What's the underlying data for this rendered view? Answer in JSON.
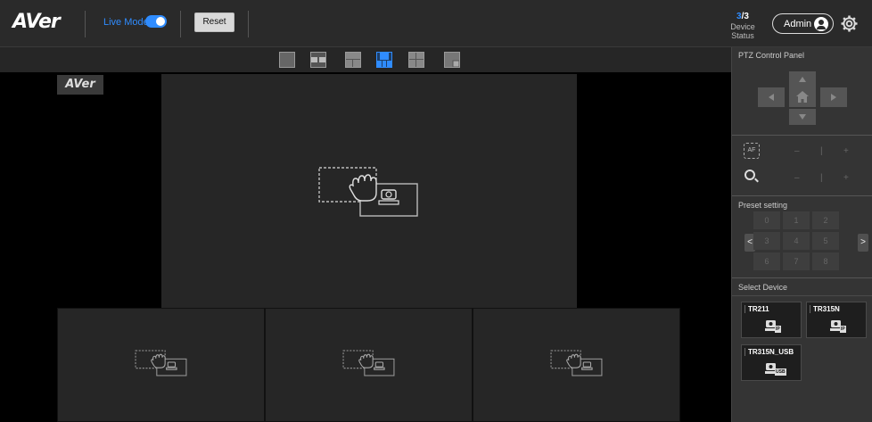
{
  "header": {
    "logo": "AVer",
    "live_mode_label": "Live Mode",
    "live_mode_on": true,
    "reset_label": "Reset",
    "device_status": {
      "connected": "3",
      "total": "3",
      "label": "Device Status"
    },
    "user_label": "Admin",
    "icons": {
      "user": "user-circle-icon",
      "settings": "gear-icon"
    }
  },
  "layouts": [
    {
      "name": "single-view",
      "active": false
    },
    {
      "name": "two-view",
      "active": false
    },
    {
      "name": "three-view-top-split",
      "active": false
    },
    {
      "name": "one-plus-three-view",
      "active": true
    },
    {
      "name": "four-view-grid",
      "active": false
    },
    {
      "name": "picture-in-picture",
      "active": false
    }
  ],
  "view": {
    "watermark": "AVer",
    "drop_hint_icon": "drag-camera-icon"
  },
  "ptz_panel": {
    "title": "PTZ Control Panel",
    "icons": [
      "up-arrow-icon",
      "left-arrow-icon",
      "home-icon",
      "right-arrow-icon",
      "down-arrow-icon"
    ],
    "af_label": "AF",
    "focus_minus": "–",
    "focus_sep": "|",
    "focus_plus": "+",
    "zoom_minus": "–",
    "zoom_sep": "|",
    "zoom_plus": "+"
  },
  "preset": {
    "title": "Preset setting",
    "prev": "<",
    "next": ">",
    "numbers": [
      "0",
      "1",
      "2",
      "3",
      "4",
      "5",
      "6",
      "7",
      "8"
    ]
  },
  "devices": {
    "title": "Select Device",
    "items": [
      {
        "name": "TR211",
        "tag": "IP"
      },
      {
        "name": "TR315N",
        "tag": "IP"
      },
      {
        "name": "TR315N_USB",
        "tag": "USB"
      }
    ]
  },
  "colors": {
    "accent": "#2f8cff",
    "panel": "#343434",
    "tile": "#262626"
  }
}
